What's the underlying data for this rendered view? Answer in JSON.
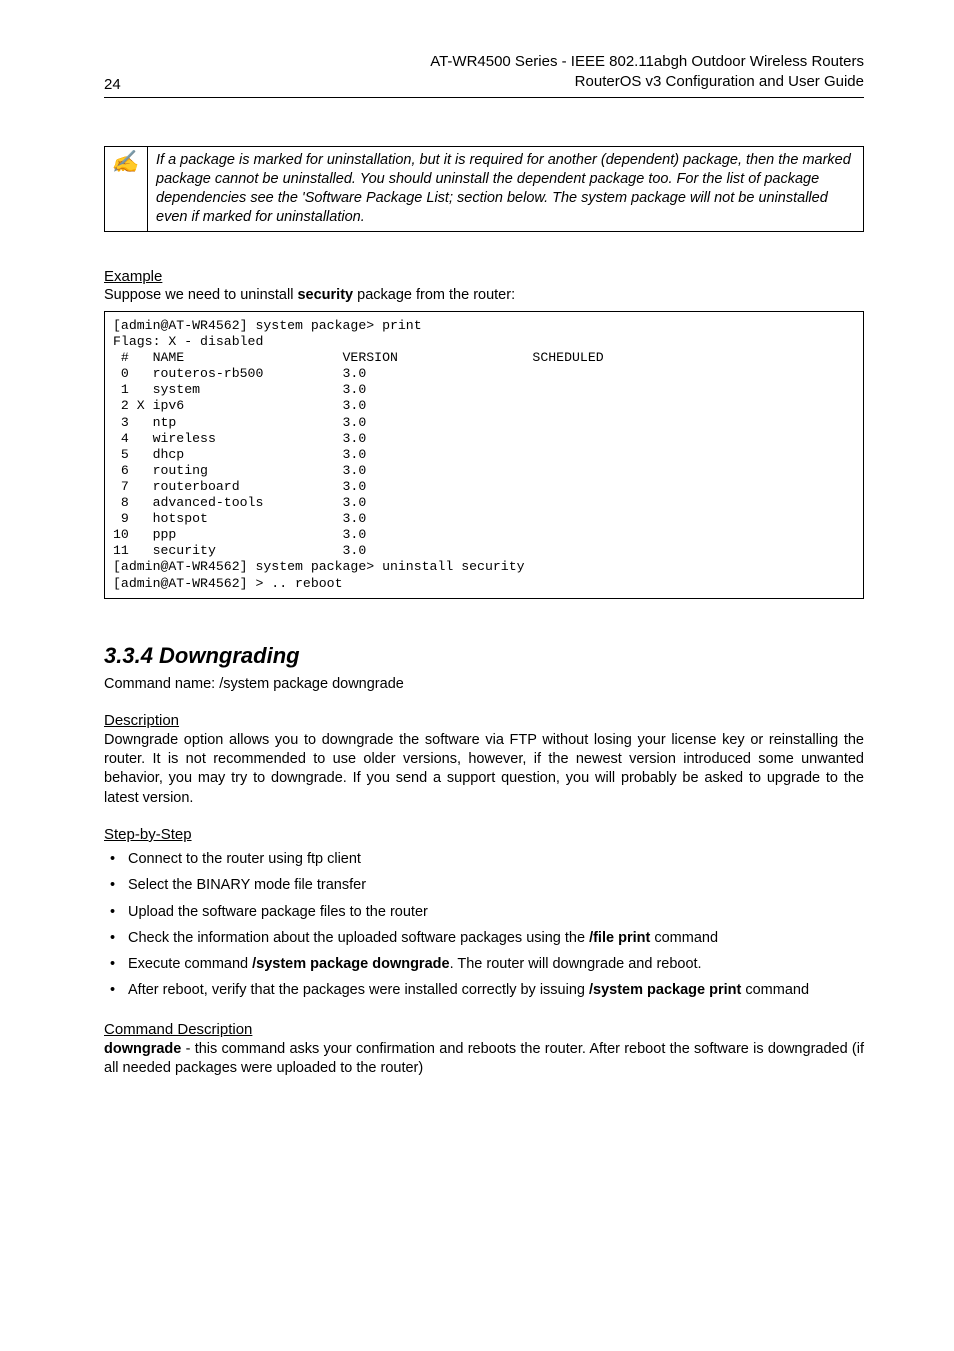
{
  "header": {
    "page_num": "24",
    "title_line1": "AT-WR4500 Series - IEEE 802.11abgh Outdoor Wireless Routers",
    "title_line2": "RouterOS v3 Configuration and User Guide"
  },
  "note": {
    "icon": "✍",
    "text": "If a package is marked for uninstallation, but it is required for another (dependent) package, then the marked package cannot be uninstalled. You should uninstall the dependent package too. For the list of package dependencies see the 'Software Package List; section below. The system package will not be uninstalled even if marked for uninstallation."
  },
  "example": {
    "heading": "Example",
    "caption_pre": "Suppose we need to uninstall ",
    "caption_bold": "security",
    "caption_post": " package from the router:",
    "code": "[admin@AT-WR4562] system package> print\nFlags: X - disabled\n #   NAME                    VERSION                 SCHEDULED\n 0   routeros-rb500          3.0\n 1   system                  3.0\n 2 X ipv6                    3.0\n 3   ntp                     3.0\n 4   wireless                3.0\n 5   dhcp                    3.0\n 6   routing                 3.0\n 7   routerboard             3.0\n 8   advanced-tools          3.0\n 9   hotspot                 3.0\n10   ppp                     3.0\n11   security                3.0\n[admin@AT-WR4562] system package> uninstall security\n[admin@AT-WR4562] > .. reboot"
  },
  "downgrade": {
    "heading": "3.3.4 Downgrading",
    "command_line": "Command name: /system package downgrade",
    "desc_heading": "Description",
    "desc_text": "Downgrade option allows you to downgrade the software via FTP without losing your license key or reinstalling the router. It is not recommended to use older versions, however, if the newest version introduced some unwanted behavior, you may try to downgrade. If you send a support question, you will probably be asked to upgrade to the latest version.",
    "steps_heading": "Step-by-Step",
    "steps": [
      {
        "pre": "Connect to the router using ftp client"
      },
      {
        "pre": "Select the BINARY mode file transfer"
      },
      {
        "pre": "Upload the software package files to the router"
      },
      {
        "pre": "Check the information about the uploaded software packages using the ",
        "b1": "/file print",
        "post1": " command"
      },
      {
        "pre": "Execute command ",
        "b1": "/system package downgrade",
        "post1": ". The router will downgrade and reboot."
      },
      {
        "pre": "After reboot, verify that the packages were installed correctly by issuing ",
        "b1": "/system package print",
        "post1": " command"
      }
    ],
    "cmd_desc_heading": "Command Description",
    "cmd_desc_bold": "downgrade",
    "cmd_desc_rest": " - this command asks your confirmation and reboots the router. After reboot the software is downgraded (if all needed packages were uploaded to the router)"
  }
}
